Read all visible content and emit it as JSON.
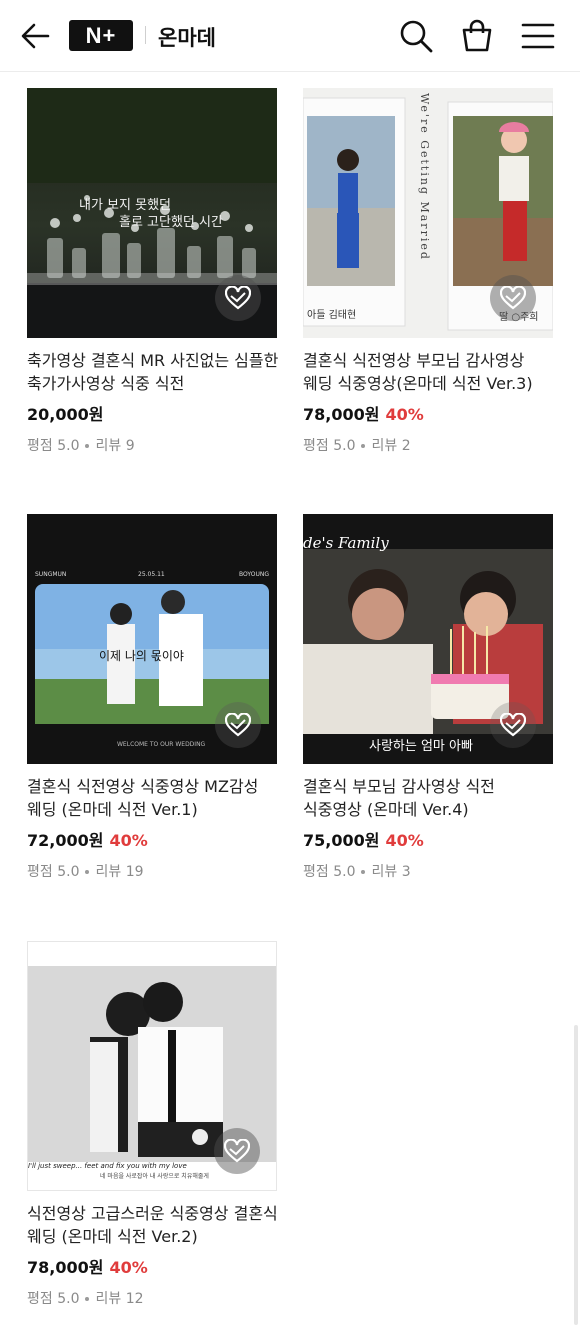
{
  "header": {
    "logo_text": "N+",
    "brand": "온마데",
    "icons": [
      "back-arrow-icon",
      "search-icon",
      "shopping-bag-icon",
      "menu-icon"
    ]
  },
  "products": [
    {
      "title": "축가영상 결혼식 MR 사진없는 심플한 축가가사영상 식중 식전",
      "price": "20,000원",
      "discount": "",
      "rating_label": "평점 5.0",
      "review_label": "리뷰 9",
      "thumb_text": [
        "내가 보지 못했던",
        "홀로 고단했던 시간"
      ]
    },
    {
      "title": "결혼식 식전영상 부모님 감사영상 웨딩 식중영상(온마데 식전 Ver.3)",
      "price": "78,000원",
      "discount": "40%",
      "rating_label": "평점 5.0",
      "review_label": "리뷰 2",
      "thumb_text": [
        "We're Getting Married",
        "아들 김태현",
        "딸 ○주희"
      ]
    },
    {
      "title": "결혼식 식전영상 식중영상 MZ감성 웨딩 (온마데 식전 Ver.1)",
      "price": "72,000원",
      "discount": "40%",
      "rating_label": "평점 5.0",
      "review_label": "리뷰 19",
      "thumb_text": [
        "SUNGMUN",
        "25.05.11",
        "BOYOUNG",
        "이제 나의 몫이야",
        "WELCOME TO OUR WEDDING"
      ]
    },
    {
      "title": "결혼식 부모님 감사영상 식전 식중영상 (온마데 Ver.4)",
      "price": "75,000원",
      "discount": "40%",
      "rating_label": "평점 5.0",
      "review_label": "리뷰 3",
      "thumb_text": [
        "de's Family",
        "사랑하는 엄마 아빠"
      ]
    },
    {
      "title": "식전영상 고급스러운 식중영상 결혼식 웨딩 (온마데 식전 Ver.2)",
      "price": "78,000원",
      "discount": "40%",
      "rating_label": "평점 5.0",
      "review_label": "리뷰 12",
      "thumb_text": [
        "I'll just sweep... feet and fix you with my love",
        "네 마음을 사로잡아 내 사랑으로 치유해줄게"
      ]
    }
  ]
}
